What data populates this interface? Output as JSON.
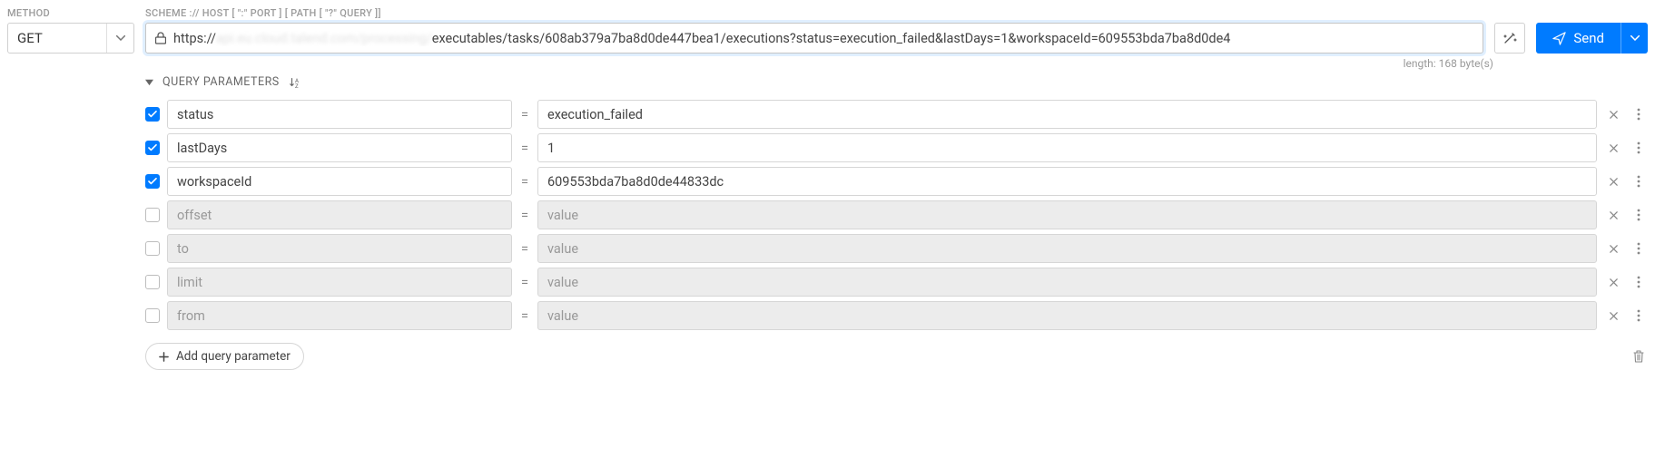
{
  "labels": {
    "method": "METHOD",
    "scheme": "SCHEME :// HOST [ \":\" PORT ] [ PATH [ \"?\" QUERY ]]",
    "query_parameters": "QUERY PARAMETERS",
    "add_query": "Add query parameter",
    "send": "Send"
  },
  "method": {
    "value": "GET"
  },
  "url": {
    "prefix": "https://",
    "blurred": "api.eu.cloud.talend.com/processing/",
    "rest": "executables/tasks/608ab379a7ba8d0de447bea1/executions?status=execution_failed&lastDays=1&workspaceId=609553bda7ba8d0de4",
    "length_text": "length: 168 byte(s)"
  },
  "params": [
    {
      "checked": true,
      "name": "status",
      "value": "execution_failed",
      "placeholder": "value"
    },
    {
      "checked": true,
      "name": "lastDays",
      "value": "1",
      "placeholder": "value"
    },
    {
      "checked": true,
      "name": "workspaceId",
      "value": "609553bda7ba8d0de44833dc",
      "placeholder": "value"
    },
    {
      "checked": false,
      "name": "offset",
      "value": "",
      "placeholder": "value"
    },
    {
      "checked": false,
      "name": "to",
      "value": "",
      "placeholder": "value"
    },
    {
      "checked": false,
      "name": "limit",
      "value": "",
      "placeholder": "value"
    },
    {
      "checked": false,
      "name": "from",
      "value": "",
      "placeholder": "value"
    }
  ]
}
